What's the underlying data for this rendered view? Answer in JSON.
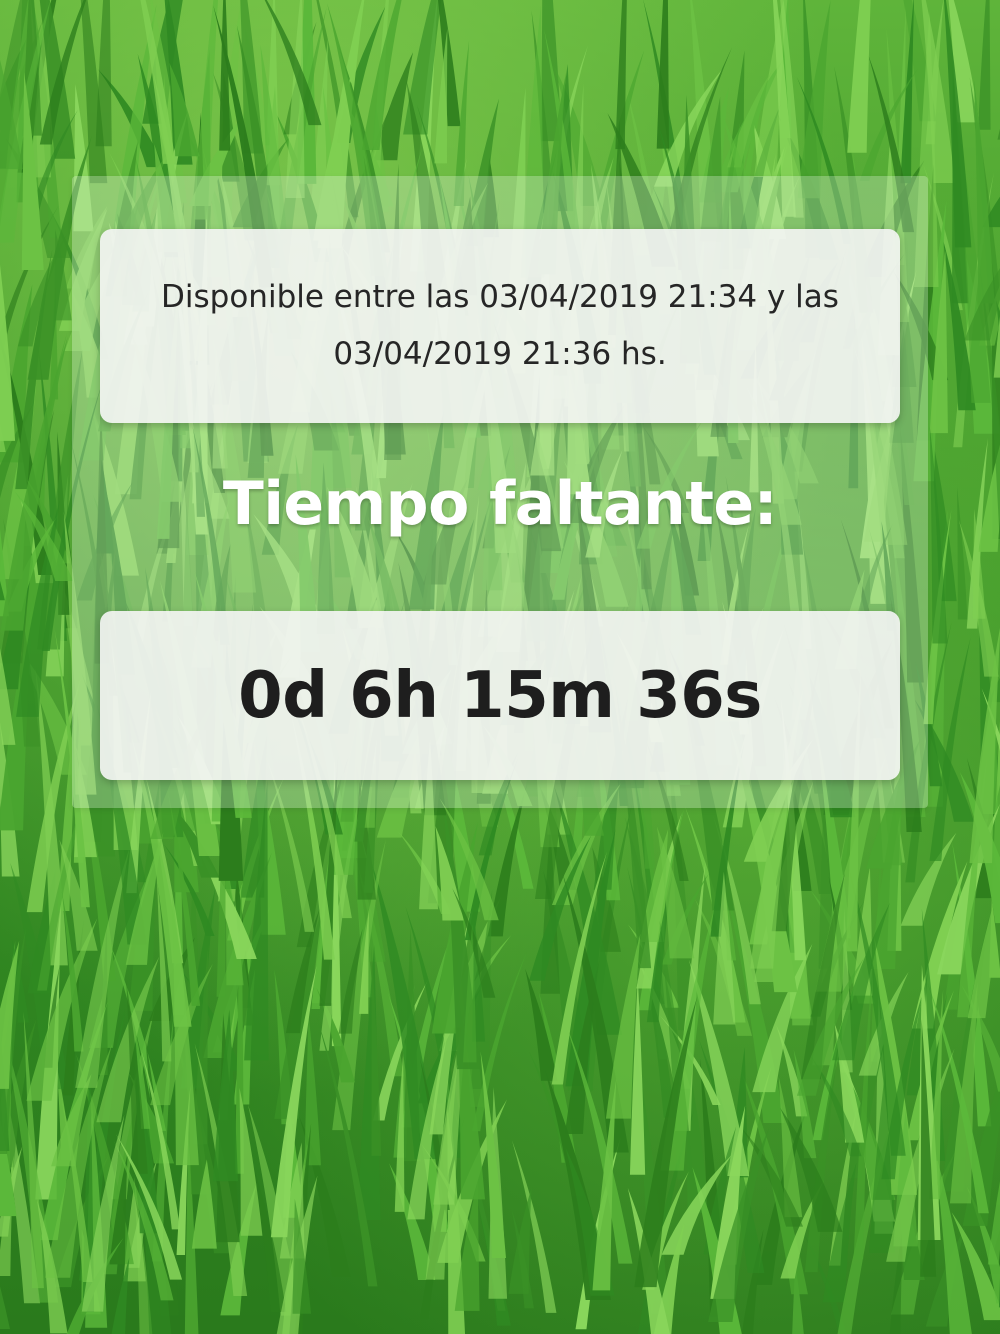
{
  "background": {
    "image": "grass",
    "colors": {
      "light_green": "#6cc244",
      "mid_green": "#3d9628",
      "dark_green": "#2a7a1c"
    }
  },
  "availability": {
    "text": "Disponible entre las 03/04/2019 21:34 y las 03/04/2019 21:36 hs."
  },
  "remaining": {
    "heading": "Tiempo faltante:",
    "countdown": "0d 6h 15m 36s"
  }
}
